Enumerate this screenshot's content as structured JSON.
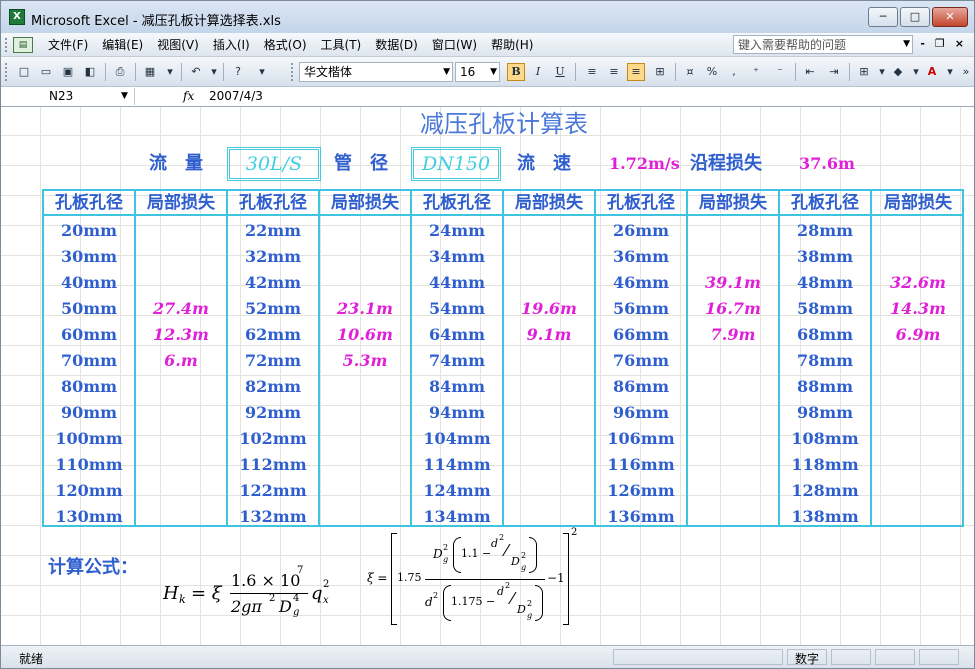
{
  "window": {
    "title": "Microsoft Excel - 减压孔板计算选择表.xls",
    "app_icon": "X",
    "minimize": "─",
    "maximize": "□",
    "close": "✕"
  },
  "menu": {
    "items": [
      "文件(F)",
      "编辑(E)",
      "视图(V)",
      "插入(I)",
      "格式(O)",
      "工具(T)",
      "数据(D)",
      "窗口(W)",
      "帮助(H)"
    ],
    "help_placeholder": "键入需要帮助的问题",
    "mdi_min": "-",
    "mdi_restore": "❐",
    "mdi_close": "×"
  },
  "toolbar": {
    "font": "华文楷体",
    "size": "16",
    "bold": "B",
    "italic": "I",
    "underline": "U",
    "percent": "%",
    "comma": ","
  },
  "formula_bar": {
    "name_box": "N23",
    "fx": "fx",
    "value": "2007/4/3"
  },
  "sheet": {
    "title": "减压孔板计算表",
    "params": {
      "flow_label": "流　量",
      "flow_value": "30L/S",
      "pipe_label": "管　径",
      "pipe_value": "DN150",
      "speed_label": "流　速",
      "speed_value": "1.72m/s",
      "loss_label": "沿程损失",
      "loss_value": "37.6m"
    },
    "headers": [
      "孔板孔径",
      "局部损失",
      "孔板孔径",
      "局部损失",
      "孔板孔径",
      "局部损失",
      "孔板孔径",
      "局部损失",
      "孔板孔径",
      "局部损失"
    ],
    "columns": [
      [
        "20mm",
        "30mm",
        "40mm",
        "50mm",
        "60mm",
        "70mm",
        "80mm",
        "90mm",
        "100mm",
        "110mm",
        "120mm",
        "130mm"
      ],
      [
        "",
        "",
        "",
        "27.4m",
        "12.3m",
        "6.m",
        "",
        "",
        "",
        "",
        "",
        ""
      ],
      [
        "22mm",
        "32mm",
        "42mm",
        "52mm",
        "62mm",
        "72mm",
        "82mm",
        "92mm",
        "102mm",
        "112mm",
        "122mm",
        "132mm"
      ],
      [
        "",
        "",
        "",
        "23.1m",
        "10.6m",
        "5.3m",
        "",
        "",
        "",
        "",
        "",
        ""
      ],
      [
        "24mm",
        "34mm",
        "44mm",
        "54mm",
        "64mm",
        "74mm",
        "84mm",
        "94mm",
        "104mm",
        "114mm",
        "124mm",
        "134mm"
      ],
      [
        "",
        "",
        "",
        "19.6m",
        "9.1m",
        "",
        "",
        "",
        "",
        "",
        "",
        ""
      ],
      [
        "26mm",
        "36mm",
        "46mm",
        "56mm",
        "66mm",
        "76mm",
        "86mm",
        "96mm",
        "106mm",
        "116mm",
        "126mm",
        "136mm"
      ],
      [
        "",
        "",
        "39.1m",
        "16.7m",
        "7.9m",
        "",
        "",
        "",
        "",
        "",
        "",
        ""
      ],
      [
        "28mm",
        "38mm",
        "48mm",
        "58mm",
        "68mm",
        "78mm",
        "88mm",
        "98mm",
        "108mm",
        "118mm",
        "128mm",
        "138mm"
      ],
      [
        "",
        "",
        "32.6m",
        "14.3m",
        "6.9m",
        "",
        "",
        "",
        "",
        "",
        "",
        ""
      ]
    ],
    "calc_label": "计算公式：",
    "formula1": {
      "lhs": "H",
      "lhs_sub": "k",
      "eq": "= ξ",
      "num": "1.6 × 10",
      "num_sup": "7",
      "den": "2gπ",
      "den_sup": "2",
      "den_d": "D",
      "den_d_sup": "4",
      "den_d_sub": "g",
      "tail": "q",
      "tail_sup": "2",
      "tail_sub": "x"
    },
    "formula2": {
      "lhs": "ξ =",
      "coef": "1.75",
      "num_d": "D",
      "num_d_sup": "2",
      "num_d_sub": "g",
      "num_paren": "1.1 −",
      "d2": "d",
      "d2_sup": "2",
      "dg": "D",
      "dg_sup": "2",
      "dg_sub": "g",
      "den_d": "d",
      "den_d_sup": "2",
      "den_paren": "1.175 −",
      "minus1": "−1",
      "outer_sup": "2"
    }
  },
  "status": {
    "ready": "就绪",
    "numlock": "数字"
  }
}
